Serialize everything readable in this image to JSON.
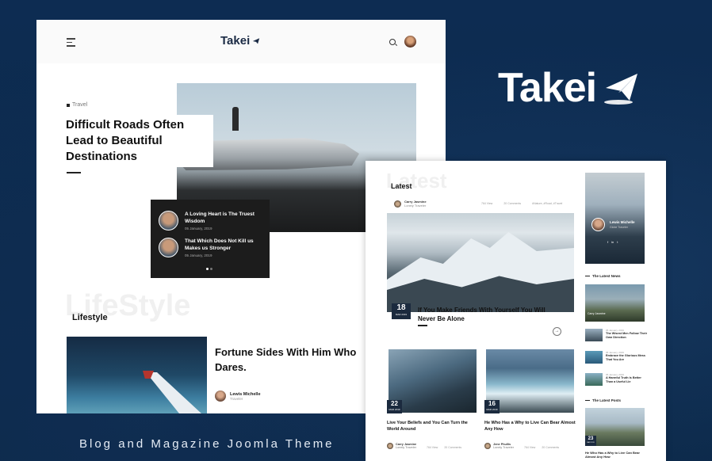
{
  "brand": {
    "name": "Takei",
    "tagline": "Blog and Magazine Joomla Theme"
  },
  "left_page": {
    "logo": "Takei",
    "hero": {
      "category": "Travel",
      "title": "Difficult Roads Often Lead to Beautiful Destinations"
    },
    "slider_items": [
      {
        "title": "A Loving Heart is The Truest Wisdom",
        "date": "05 January, 2019"
      },
      {
        "title": "That Which Does Not Kill us Makes us Stronger",
        "date": "05 January, 2019"
      }
    ],
    "section": {
      "ghost": "LifeStyle",
      "title": "Lifestyle"
    },
    "feature": {
      "title": "Fortune Sides With Him Who Dares.",
      "author": "Lewis Michelle",
      "role": "Traveler"
    }
  },
  "right_page": {
    "ghost": "Latest",
    "title": "Latest",
    "top_meta": {
      "author": "Carry Jasmine",
      "role": "Lonely Traveler",
      "views": "764 View",
      "comments": "20 Comments",
      "tags": "#Nature, #Road, #Travel"
    },
    "main_post": {
      "day": "18",
      "month": "MAR 2019",
      "title": "If You Make Friends With Yourself You Will Never Be Alone"
    },
    "cards": [
      {
        "day": "22",
        "month": "MAR 2019",
        "title": "Live Your Beliefs and You Can Turn the World Around",
        "author": "Carry Jasmine",
        "role": "Lonely Traveler",
        "views": "764 View",
        "comments": "20 Comments"
      },
      {
        "day": "16",
        "month": "MAR 2019",
        "title": "He Who Has a Why to Live Can Bear Almost Any How",
        "author": "Jene Phullis",
        "role": "Lonely Traveler",
        "views": "764 View",
        "comments": "20 Comments"
      }
    ],
    "sidebar": {
      "profile": {
        "name": "Lewis Michelle",
        "role": "Globe Traveler",
        "social": [
          "f",
          "in",
          "t"
        ]
      },
      "latest_news_heading": "The Latest News",
      "feature_name": "Carry Jasmine",
      "news": [
        {
          "date": "05 January, 2019",
          "title": "The Wisest Men Follow Their Own Direction"
        },
        {
          "date": "05 January, 2019",
          "title": "Embrace the Glorious Mess That You Are"
        },
        {
          "date": "05 January, 2019",
          "title": "A Harmful Truth Is Better Than a Useful Lie"
        }
      ],
      "latest_posts_heading": "The Latest Posts",
      "latest_post": {
        "day": "23",
        "month": "MAR 2019",
        "title": "He Who Has a Why to Live Can Bear Almost Any How"
      }
    }
  },
  "colors": {
    "background": "#0c2a4e",
    "navy_badge": "#1b2a3e",
    "dark_panel": "#1c1c1c"
  }
}
